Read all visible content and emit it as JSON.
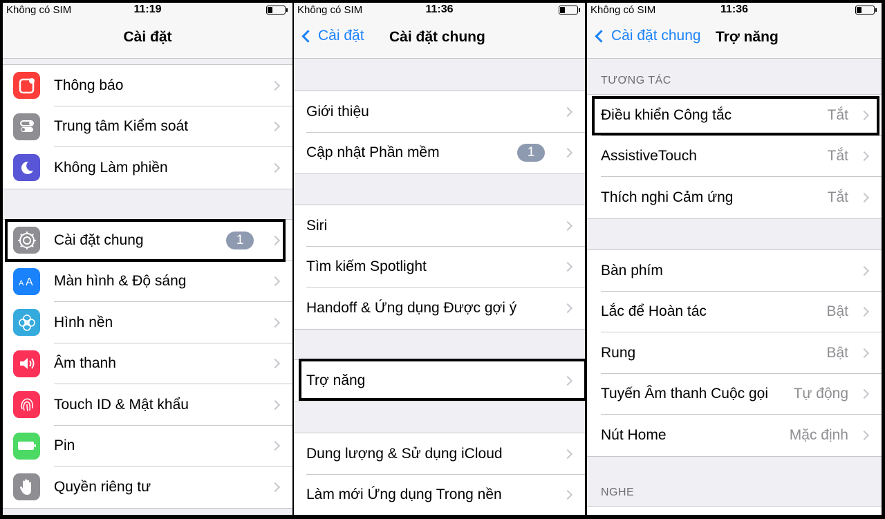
{
  "panels": [
    {
      "status": {
        "carrier": "Không có SIM",
        "time": "11:19"
      },
      "nav": {
        "title": "Cài đặt"
      },
      "groups": [
        {
          "items": [
            {
              "label": "Thông báo",
              "icon": "notifications-icon",
              "color": "#fc3d39"
            },
            {
              "label": "Trung tâm Kiểm soát",
              "icon": "control-center-icon",
              "color": "#8e8e93"
            },
            {
              "label": "Không Làm phiền",
              "icon": "moon-icon",
              "color": "#5856d6"
            }
          ]
        },
        {
          "items": [
            {
              "label": "Cài đặt chung",
              "icon": "gear-icon",
              "color": "#8e8e93",
              "badge": "1"
            },
            {
              "label": "Màn hình & Độ sáng",
              "icon": "display-brightness-icon",
              "color": "#1a82fb"
            },
            {
              "label": "Hình nền",
              "icon": "wallpaper-flower-icon",
              "color": "#35aadc"
            },
            {
              "label": "Âm thanh",
              "icon": "speaker-icon",
              "color": "#fc3158"
            },
            {
              "label": "Touch ID & Mật khẩu",
              "icon": "fingerprint-icon",
              "color": "#fc3158"
            },
            {
              "label": "Pin",
              "icon": "battery-icon",
              "color": "#4cd964"
            },
            {
              "label": "Quyền riêng tư",
              "icon": "hand-icon",
              "color": "#8e8e93"
            }
          ]
        }
      ]
    },
    {
      "status": {
        "carrier": "Không có SIM",
        "time": "11:36"
      },
      "nav": {
        "back": "Cài đặt",
        "title": "Cài đặt chung"
      },
      "groups": [
        {
          "items": [
            {
              "label": "Giới thiệu"
            },
            {
              "label": "Cập nhật Phần mềm",
              "badge": "1"
            }
          ]
        },
        {
          "items": [
            {
              "label": "Siri"
            },
            {
              "label": "Tìm kiếm Spotlight"
            },
            {
              "label": "Handoff & Ứng dụng Được gợi ý"
            }
          ]
        },
        {
          "items": [
            {
              "label": "Trợ năng"
            }
          ]
        },
        {
          "items": [
            {
              "label": "Dung lượng & Sử dụng iCloud"
            },
            {
              "label": "Làm mới Ứng dụng Trong nền"
            }
          ]
        }
      ]
    },
    {
      "status": {
        "carrier": "Không có SIM",
        "time": "11:36"
      },
      "nav": {
        "back": "Cài đặt chung",
        "title": "Trợ năng"
      },
      "sections": [
        {
          "header": "TƯƠNG TÁC",
          "items": [
            {
              "label": "Điều khiển Công tắc",
              "value": "Tắt"
            },
            {
              "label": "AssistiveTouch",
              "value": "Tắt"
            },
            {
              "label": "Thích nghi Cảm ứng",
              "value": "Tắt"
            }
          ]
        },
        {
          "header": "",
          "items": [
            {
              "label": "Bàn phím",
              "value": ""
            },
            {
              "label": "Lắc để Hoàn tác",
              "value": "Bật"
            },
            {
              "label": "Rung",
              "value": "Bật"
            },
            {
              "label": "Tuyến Âm thanh Cuộc gọi",
              "value": "Tự động"
            },
            {
              "label": "Nút Home",
              "value": "Mặc định"
            }
          ]
        },
        {
          "header": "NGHE",
          "items": []
        }
      ]
    }
  ],
  "colors": {
    "accent": "#1a82fb",
    "background": "#efeff4",
    "separator": "#c8c7cc",
    "badge": "#8e9aaf"
  }
}
